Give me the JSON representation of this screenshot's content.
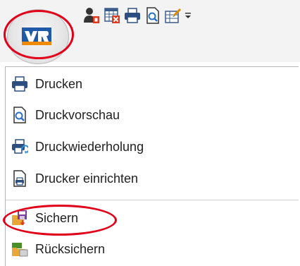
{
  "quick_access": {
    "icons": [
      "user-permission-icon",
      "calendar-delete-icon",
      "printer-icon",
      "print-preview-icon",
      "bulk-edit-icon",
      "customize-toolbar-icon"
    ],
    "app_logo": "vr-bank-logo"
  },
  "menu": {
    "items": [
      {
        "label": "Drucken",
        "icon": "printer-icon"
      },
      {
        "label": "Druckvorschau",
        "icon": "print-preview-icon"
      },
      {
        "label": "Druckwiederholung",
        "icon": "print-repeat-icon"
      },
      {
        "label": "Drucker einrichten",
        "icon": "printer-setup-icon"
      },
      {
        "label": "Sichern",
        "icon": "save-backup-icon"
      },
      {
        "label": "Rücksichern",
        "icon": "restore-backup-icon"
      }
    ]
  },
  "colors": {
    "highlight": "#e0001a",
    "logo_blue": "#1e5aa8",
    "logo_orange": "#f08a00"
  }
}
